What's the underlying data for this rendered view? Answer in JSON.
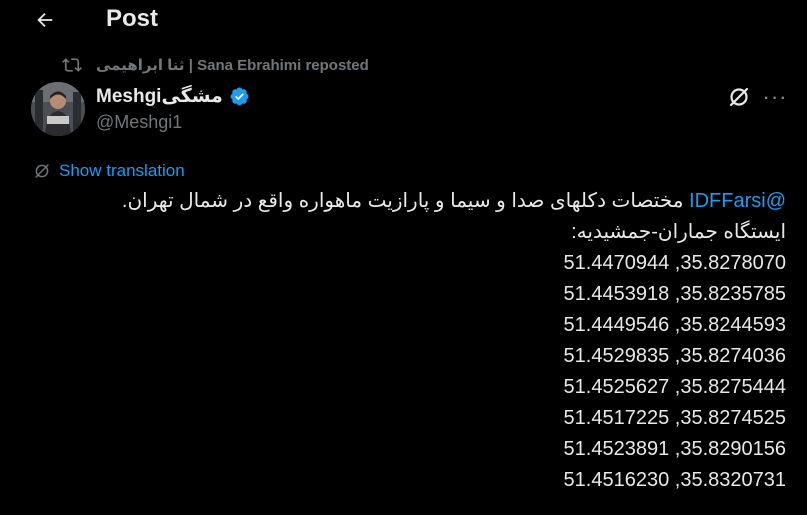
{
  "header": {
    "title": "Post"
  },
  "repost": {
    "text": "ثنا ابراهیمی | Sana Ebrahimi reposted"
  },
  "author": {
    "name": "Meshgiمشگی",
    "handle": "@Meshgi1"
  },
  "translate": {
    "label": "Show translation"
  },
  "tweet": {
    "mention": "@IDFFarsi",
    "line1_rest": " مختصات دکلهای صدا و سیما و پارازیت ماهواره واقع در شمال تهران.",
    "line2": "ایستگاه جماران-جمشیدیه:",
    "coords": [
      "51.4470944 ,35.8278070",
      "51.4453918 ,35.8235785",
      "51.4449546 ,35.8244593",
      "51.4529835 ,35.8274036",
      "51.4525627 ,35.8275444",
      "51.4517225 ,35.8274525",
      "51.4523891 ,35.8290156",
      "51.4516230 ,35.8320731"
    ]
  },
  "colors": {
    "accent": "#1d9bf0",
    "text": "#e7e9ea",
    "muted": "#71767b",
    "background": "#000000"
  },
  "icons": [
    "back-arrow-icon",
    "repost-icon",
    "verified-badge-icon",
    "grok-icon",
    "more-icon",
    "translate-icon"
  ]
}
